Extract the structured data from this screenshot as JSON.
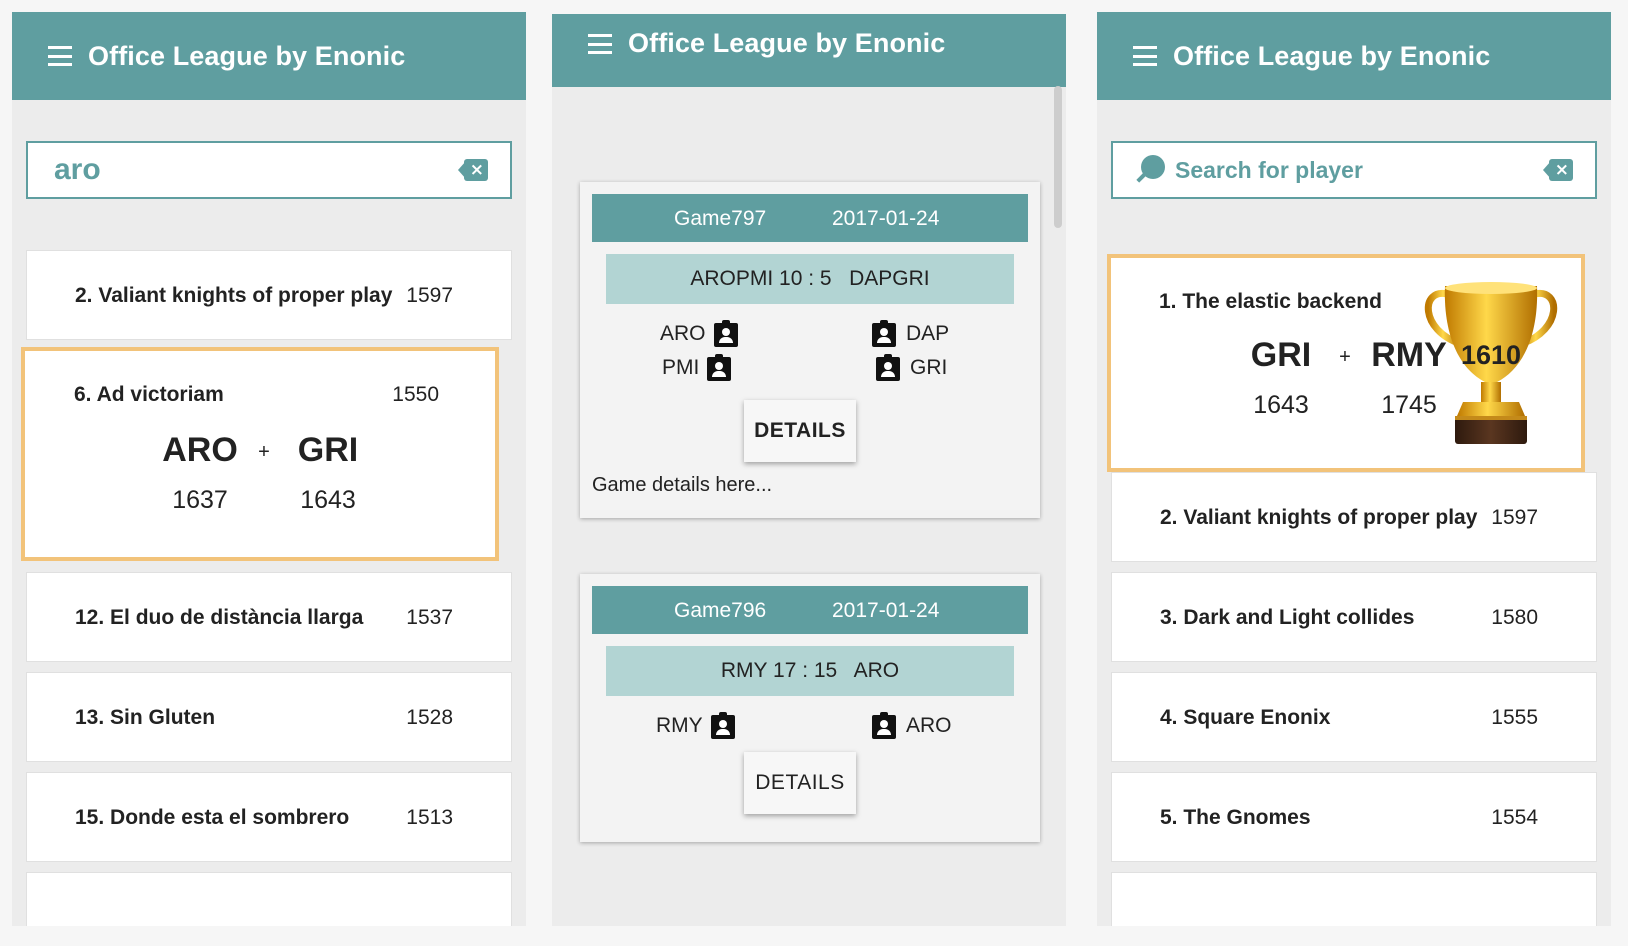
{
  "app_title": "Office League by Enonic",
  "panel1": {
    "search_value": "aro",
    "teams": [
      {
        "name": "2. Valiant knights of proper play",
        "rating": "1597"
      },
      {
        "name": "6. Ad victoriam",
        "rating": "1550",
        "players": [
          {
            "name": "ARO",
            "rating": "1637"
          },
          {
            "name": "GRI",
            "rating": "1643"
          }
        ],
        "plus": "+"
      },
      {
        "name": "12. El duo de distància llarga",
        "rating": "1537"
      },
      {
        "name": "13. Sin Gluten",
        "rating": "1528"
      },
      {
        "name": "15. Donde esta el sombrero",
        "rating": "1513"
      }
    ]
  },
  "panel2": {
    "games": [
      {
        "id": "Game797",
        "date": "2017-01-24",
        "score": "AROPMI 10 : 5   DAPGRI",
        "left_players": [
          "ARO",
          "PMI"
        ],
        "right_players": [
          "DAP",
          "GRI"
        ],
        "details_label": "DETAILS",
        "note": "Game details here..."
      },
      {
        "id": "Game796",
        "date": "2017-01-24",
        "score": "RMY 17 : 15   ARO",
        "left_players": [
          "RMY"
        ],
        "right_players": [
          "ARO"
        ],
        "details_label": "DETAILS"
      }
    ]
  },
  "panel3": {
    "search_placeholder": "Search for player",
    "teams": [
      {
        "name": "1. The elastic backend",
        "players": [
          {
            "name": "GRI",
            "rating": "1643"
          },
          {
            "name": "RMY",
            "rating": "1745"
          }
        ],
        "plus": "+",
        "trophy_rating": "1610"
      },
      {
        "name": "2. Valiant knights of proper play",
        "rating": "1597"
      },
      {
        "name": "3. Dark and Light collides",
        "rating": "1580"
      },
      {
        "name": "4. Square Enonix",
        "rating": "1555"
      },
      {
        "name": "5. The Gnomes",
        "rating": "1554"
      }
    ]
  },
  "colors": {
    "primary": "#5f9ea0",
    "score_bg": "#b2d4d3",
    "highlight": "#f2c37a",
    "trophy_gold": "#e8a317"
  },
  "icons": [
    "menu-icon",
    "backspace-icon",
    "search-icon",
    "contact-badge-icon",
    "trophy-icon"
  ]
}
